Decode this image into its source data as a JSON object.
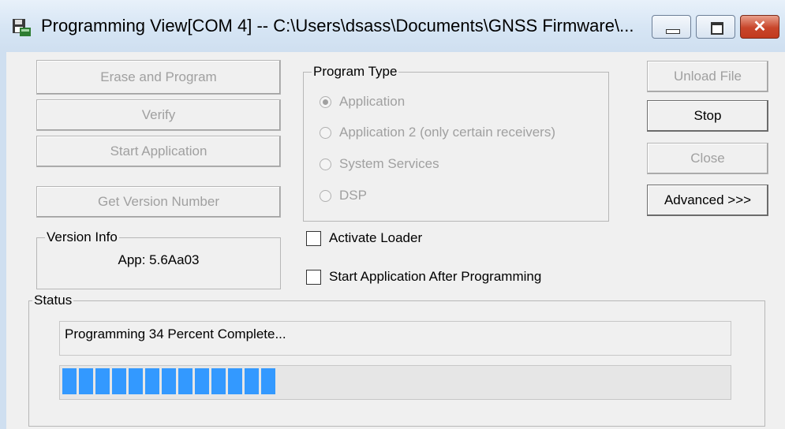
{
  "window": {
    "title": "Programming View[COM 4] -- C:\\Users\\dsass\\Documents\\GNSS Firmware\\...",
    "close_glyph": "✕"
  },
  "left_buttons": {
    "erase_and_program": "Erase and Program",
    "verify": "Verify",
    "start_application": "Start Application",
    "get_version_number": "Get Version Number"
  },
  "program_type": {
    "label": "Program Type",
    "options": [
      {
        "label": "Application",
        "selected": true
      },
      {
        "label": "Application 2 (only certain receivers)",
        "selected": false
      },
      {
        "label": "System Services",
        "selected": false
      },
      {
        "label": "DSP",
        "selected": false
      }
    ]
  },
  "right_buttons": {
    "unload_file": "Unload File",
    "stop": "Stop",
    "close": "Close",
    "advanced": "Advanced >>>"
  },
  "version_info": {
    "label": "Version Info",
    "value": "App: 5.6Aa03"
  },
  "checkboxes": {
    "activate_loader": "Activate Loader",
    "start_after_programming": "Start Application After Programming"
  },
  "status": {
    "label": "Status",
    "message": "Programming 34 Percent Complete...",
    "progress_percent": 34,
    "progress_color": "#3399ff"
  }
}
